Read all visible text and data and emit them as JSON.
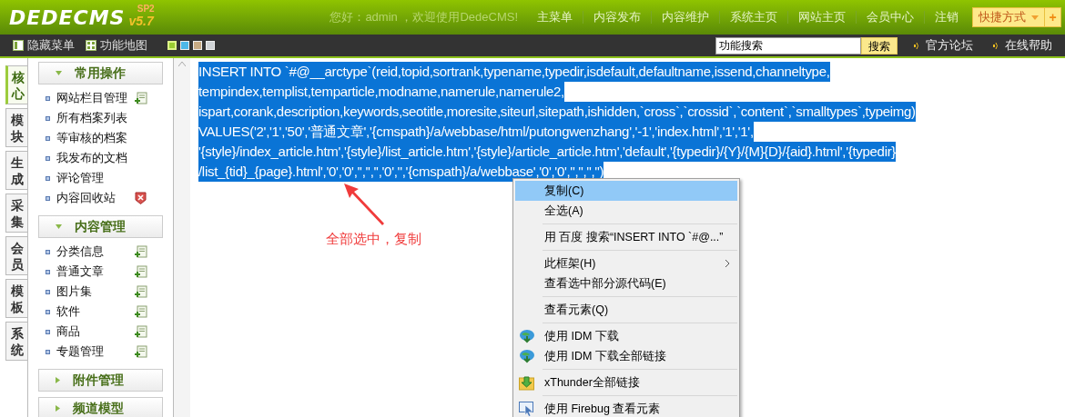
{
  "header": {
    "logo": "DEDECMS",
    "version": "v5.7",
    "edition": "SP2",
    "greeting": "您好：admin ，欢迎使用DedeCMS!",
    "nav": [
      "主菜单",
      "内容发布",
      "内容维护",
      "系统主页",
      "网站主页",
      "会员中心",
      "注销"
    ],
    "shortcut": "快捷方式",
    "add": "+"
  },
  "toolbar": {
    "hide_menu": "隐藏菜单",
    "site_map": "功能地图",
    "themes": [
      {
        "color": "#9acd32",
        "selected": true
      },
      {
        "color": "#4db8e8",
        "selected": false
      },
      {
        "color": "#c8ab84",
        "selected": false
      },
      {
        "color": "#d0d3d6",
        "selected": false
      }
    ],
    "search": {
      "value": "功能搜索",
      "button": "搜索"
    },
    "links": [
      "官方论坛",
      "在线帮助"
    ]
  },
  "side_tabs": [
    {
      "label": "核心",
      "selected": true
    },
    {
      "label": "模块",
      "selected": false
    },
    {
      "label": "生成",
      "selected": false
    },
    {
      "label": "采集",
      "selected": false
    },
    {
      "label": "会员",
      "selected": false
    },
    {
      "label": "模板",
      "selected": false
    },
    {
      "label": "系统",
      "selected": false
    }
  ],
  "sidebar": [
    {
      "title": "常用操作",
      "expanded": true,
      "items": [
        {
          "label": "网站栏目管理",
          "kind": "add"
        },
        {
          "label": "所有档案列表",
          "kind": "none"
        },
        {
          "label": "等审核的档案",
          "kind": "none"
        },
        {
          "label": "我发布的文档",
          "kind": "none"
        },
        {
          "label": "评论管理",
          "kind": "none"
        },
        {
          "label": "内容回收站",
          "kind": "delete"
        }
      ]
    },
    {
      "title": "内容管理",
      "expanded": true,
      "items": [
        {
          "label": "分类信息",
          "kind": "add"
        },
        {
          "label": "普通文章",
          "kind": "add"
        },
        {
          "label": "图片集",
          "kind": "add"
        },
        {
          "label": "软件",
          "kind": "add"
        },
        {
          "label": "商品",
          "kind": "add"
        },
        {
          "label": "专题管理",
          "kind": "add"
        }
      ]
    },
    {
      "title": "附件管理",
      "expanded": false
    },
    {
      "title": "频道模型",
      "expanded": false
    }
  ],
  "main": {
    "sql_lines": [
      "INSERT INTO `#@__arctype`(reid,topid,sortrank,typename,typedir,isdefault,defaultname,issend,channeltype,",
      "tempindex,templist,temparticle,modname,namerule,namerule2,",
      "ispart,corank,description,keywords,seotitle,moresite,siteurl,sitepath,ishidden,`cross`,`crossid`,`content`,`smalltypes`,typeimg)",
      "VALUES('2','1','50','普通文章','{cmspath}/a/webbase/html/putongwenzhang','-1','index.html','1','1',",
      "'{style}/index_article.htm','{style}/list_article.htm','{style}/article_article.htm','default','{typedir}/{Y}/{M}{D}/{aid}.html','{typedir}",
      "/list_{tid}_{page}.html','0','0','','','','0','','{cmspath}/a/webbase','0','0','','','','')"
    ],
    "annotation": "全部选中，复制"
  },
  "context_menu": [
    {
      "kind": "text",
      "label": "复制(C)",
      "selected": true
    },
    {
      "kind": "text",
      "label": "全选(A)",
      "selected": false
    },
    {
      "kind": "separator"
    },
    {
      "kind": "text",
      "label": "用 百度 搜索“INSERT INTO `#@...”",
      "selected": false
    },
    {
      "kind": "separator"
    },
    {
      "kind": "submenu",
      "label": "此框架(H)",
      "selected": false
    },
    {
      "kind": "text",
      "label": "查看选中部分源代码(E)",
      "selected": false
    },
    {
      "kind": "separator"
    },
    {
      "kind": "text",
      "label": "查看元素(Q)",
      "selected": false
    },
    {
      "kind": "separator"
    },
    {
      "kind": "idm",
      "label": "使用 IDM 下载",
      "selected": false
    },
    {
      "kind": "idm",
      "label": "使用 IDM 下载全部链接",
      "selected": false
    },
    {
      "kind": "separator"
    },
    {
      "kind": "thunder",
      "label": "xThunder全部链接",
      "selected": false
    },
    {
      "kind": "separator"
    },
    {
      "kind": "firebug",
      "label": "使用 Firebug 查看元素",
      "selected": false
    }
  ]
}
